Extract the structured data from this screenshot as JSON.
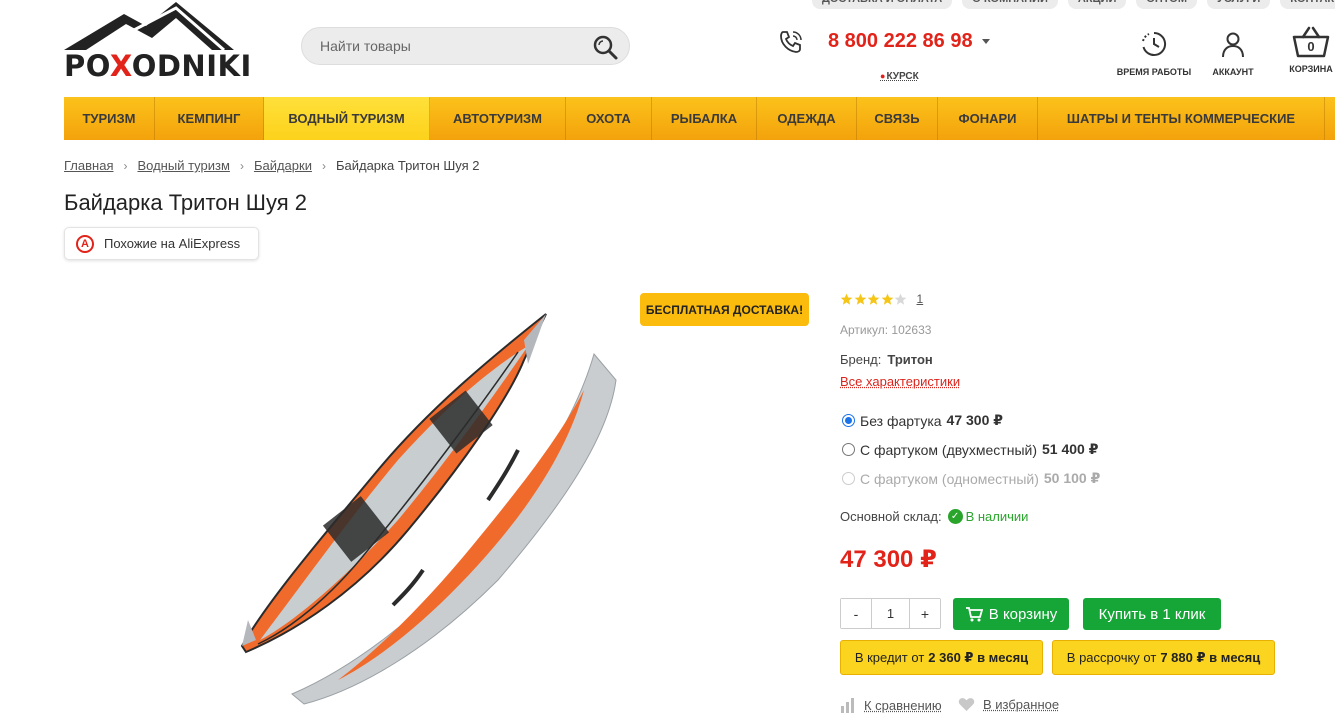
{
  "top_links": [
    "ДОСТАВКА И ОПЛАТА",
    "О КОМПАНИИ",
    "АКЦИИ",
    "ОПТОМ",
    "УСЛУГИ",
    "КОНТАКТЫ"
  ],
  "logo": {
    "text_pre": "PO",
    "text_x": "X",
    "text_post": "ODNIKI"
  },
  "search": {
    "placeholder": "Найти товары",
    "value": ""
  },
  "phone": {
    "number": "8 800 222 86 98",
    "city": "КУРСК"
  },
  "header_icons": {
    "hours": "ВРЕМЯ РАБОТЫ",
    "account": "АККАУНТ",
    "cart": "КОРЗИНА",
    "cart_count": "0"
  },
  "nav": [
    {
      "label": "ТУРИЗМ",
      "active": false
    },
    {
      "label": "КЕМПИНГ",
      "active": false
    },
    {
      "label": "ВОДНЫЙ ТУРИЗМ",
      "active": true
    },
    {
      "label": "АВТОТУРИЗМ",
      "active": false
    },
    {
      "label": "ОХОТА",
      "active": false
    },
    {
      "label": "РЫБАЛКА",
      "active": false
    },
    {
      "label": "ОДЕЖДА",
      "active": false
    },
    {
      "label": "СВЯЗЬ",
      "active": false
    },
    {
      "label": "ФОНАРИ",
      "active": false
    },
    {
      "label": "ШАТРЫ И ТЕНТЫ КОММЕРЧЕСКИЕ",
      "active": false
    }
  ],
  "breadcrumb": {
    "items": [
      "Главная",
      "Водный туризм",
      "Байдарки"
    ],
    "current": "Байдарка Тритон Шуя 2"
  },
  "product": {
    "title": "Байдарка Тритон Шуя 2",
    "ali_label": "Похожие на AliExpress",
    "ali_icon": "A",
    "badge": "БЕСПЛАТНАЯ ДОСТАВКА!",
    "rating": 4,
    "rating_max": 5,
    "reviews_count": "1",
    "sku": "Артикул: 102633",
    "brand_label": "Бренд:",
    "brand_value": "Тритон",
    "all_specs": "Все характеристики",
    "options": [
      {
        "label": "Без фартука",
        "price": "47 300 ₽",
        "selected": true,
        "disabled": false
      },
      {
        "label": "С фартуком (двухместный)",
        "price": "51 400 ₽",
        "selected": false,
        "disabled": false
      },
      {
        "label": "С фартуком (одноместный)",
        "price": "50 100 ₽",
        "selected": false,
        "disabled": true
      }
    ],
    "stock_label": "Основной склад:",
    "stock_value": "В наличии",
    "price": "47 300 ₽",
    "quantity": "1",
    "qty_minus": "-",
    "qty_plus": "+",
    "cart_button": "В корзину",
    "oneclick_button": "Купить в 1 клик",
    "credit_label": "В кредит от",
    "credit_value": "2 360 ₽ в месяц",
    "installment_label": "В рассрочку от",
    "installment_value": "7 880 ₽ в месяц",
    "compare": "К сравнению",
    "favorite": "В избранное"
  },
  "colors": {
    "accent_red": "#e2231a",
    "nav_yellow": "#fcc21b",
    "green": "#16a637",
    "badge_yellow": "#fbbc0e"
  }
}
